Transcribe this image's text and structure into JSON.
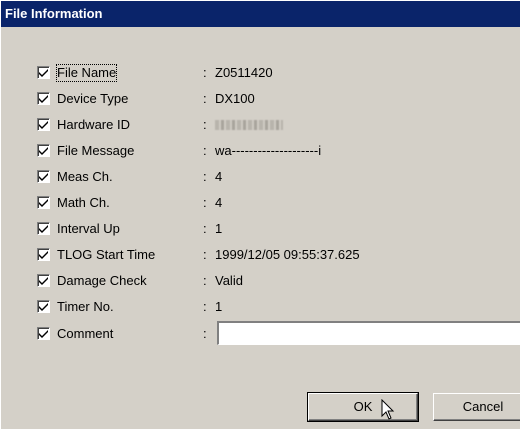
{
  "window": {
    "title": "File Information"
  },
  "fields": [
    {
      "label": "File Name",
      "separator": ":",
      "value": "Z0511420",
      "checked": true
    },
    {
      "label": "Device Type",
      "separator": ":",
      "value": "DX100",
      "checked": true
    },
    {
      "label": "Hardware ID",
      "separator": ":",
      "value": "",
      "checked": true
    },
    {
      "label": "File Message",
      "separator": ":",
      "value": "wa--------------------i",
      "checked": true
    },
    {
      "label": "Meas Ch.",
      "separator": ":",
      "value": "4",
      "checked": true
    },
    {
      "label": "Math Ch.",
      "separator": ":",
      "value": "4",
      "checked": true
    },
    {
      "label": "Interval Up",
      "separator": ":",
      "value": "1",
      "checked": true
    },
    {
      "label": "TLOG Start Time",
      "separator": ":",
      "value": "1999/12/05 09:55:37.625",
      "checked": true
    },
    {
      "label": "Damage Check",
      "separator": ":",
      "value": "Valid",
      "checked": true
    },
    {
      "label": "Timer No.",
      "separator": ":",
      "value": "1",
      "checked": true
    },
    {
      "label": "Comment",
      "separator": ":",
      "value": "",
      "checked": true
    }
  ],
  "buttons": {
    "ok_label": "OK",
    "cancel_label": "Cancel"
  },
  "colors": {
    "titlebar": "#0a246a",
    "face": "#d4d0c8"
  }
}
